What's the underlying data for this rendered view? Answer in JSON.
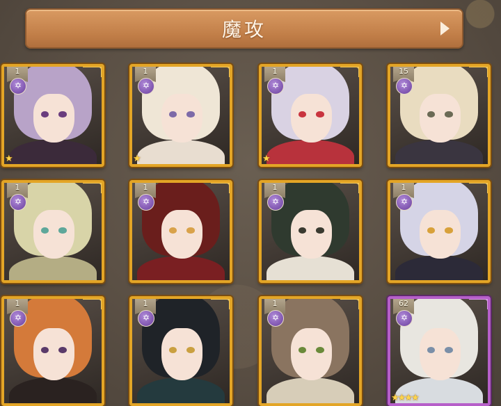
{
  "header": {
    "title": "魔攻"
  },
  "icons": {
    "next": "chevron-right-icon",
    "element": "magic-star-icon",
    "rarity": "star-icon"
  },
  "colors": {
    "header": "#c9874f",
    "frame_gold": "#e3a526",
    "frame_purple": "#b65fc9",
    "star": "#ffd54a"
  },
  "cards": [
    {
      "level": "1",
      "frame": "gold",
      "rarity_stars": "★",
      "hair": "#b8a3c8",
      "eye": "#6a3d7e",
      "body": "#3b2a3a"
    },
    {
      "level": "1",
      "frame": "gold",
      "rarity_stars": "★",
      "hair": "#efe6d6",
      "eye": "#7d6aa8",
      "body": "#e8ddd0"
    },
    {
      "level": "1",
      "frame": "gold",
      "rarity_stars": "★",
      "hair": "#d9d2e3",
      "eye": "#c9343f",
      "body": "#b8323c"
    },
    {
      "level": "15",
      "frame": "gold",
      "rarity_stars": "",
      "hair": "#e9dcc0",
      "eye": "#6b6a55",
      "body": "#3a3540"
    },
    {
      "level": "1",
      "frame": "gold",
      "rarity_stars": "",
      "hair": "#d8d4a8",
      "eye": "#5ea79a",
      "body": "#b4ad84"
    },
    {
      "level": "1",
      "frame": "gold",
      "rarity_stars": "",
      "hair": "#6a1e1c",
      "eye": "#d9a24a",
      "body": "#7a1f22"
    },
    {
      "level": "1",
      "frame": "gold",
      "rarity_stars": "",
      "hair": "#2f3a2f",
      "eye": "#3a3a30",
      "body": "#e6e0d4"
    },
    {
      "level": "1",
      "frame": "gold",
      "rarity_stars": "",
      "hair": "#d5d4e6",
      "eye": "#d8a13a",
      "body": "#2c2a38"
    },
    {
      "level": "1",
      "frame": "gold",
      "rarity_stars": "",
      "hair": "#d47a3a",
      "eye": "#5a3a6a",
      "body": "#2a2220"
    },
    {
      "level": "1",
      "frame": "gold",
      "rarity_stars": "",
      "hair": "#1f2328",
      "eye": "#caa040",
      "body": "#243a3e"
    },
    {
      "level": "1",
      "frame": "gold",
      "rarity_stars": "",
      "hair": "#8a7460",
      "eye": "#6a8a3a",
      "body": "#d7cdb8"
    },
    {
      "level": "62",
      "frame": "purple",
      "rarity_stars": "★★★★",
      "hair": "#e8e6e0",
      "eye": "#7a8fa8",
      "body": "#d8dce0"
    }
  ]
}
